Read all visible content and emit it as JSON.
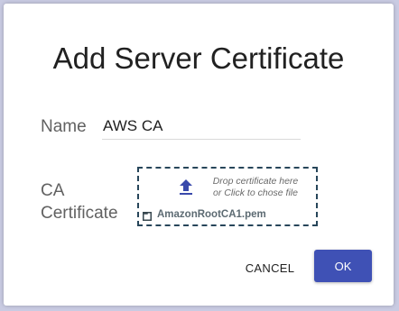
{
  "dialog": {
    "title": "Add Server Certificate",
    "name_label": "Name",
    "name_value": "AWS CA",
    "ca_label": "CA Certificate",
    "dropzone": {
      "hint_line1": "Drop certificate here",
      "hint_line2": "or Click to chose file",
      "upload_icon": "upload-icon",
      "file_icon": "file-icon",
      "file_name": "AmazonRootCA1.pem"
    },
    "cancel_label": "CANCEL",
    "ok_label": "OK"
  },
  "colors": {
    "primary": "#3f51b5",
    "dropzone_border": "#27465a",
    "upload_icon": "#3949ab"
  }
}
